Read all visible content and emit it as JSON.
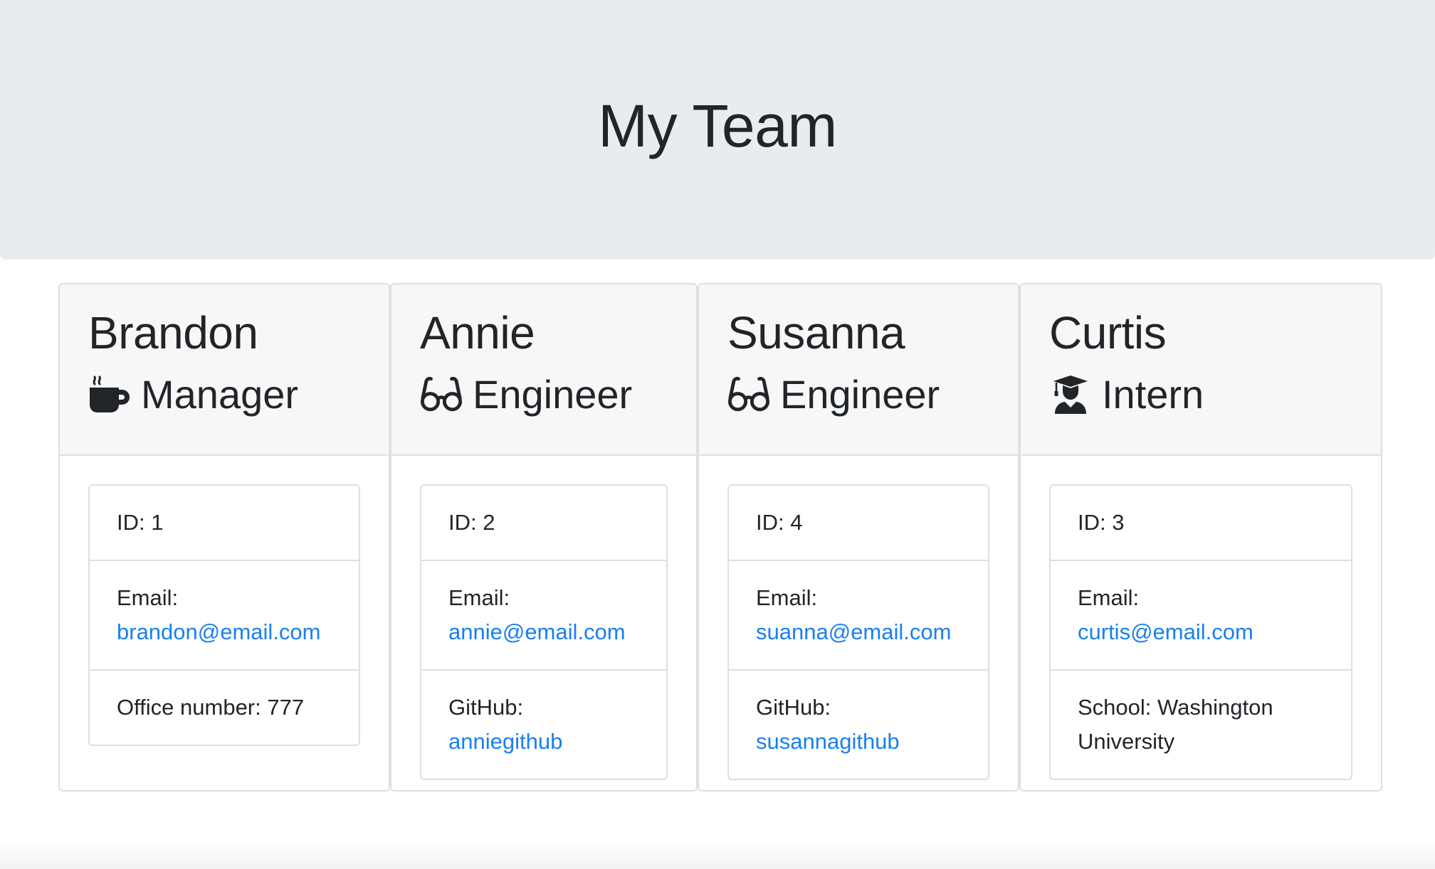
{
  "header": {
    "title": "My Team"
  },
  "team": [
    {
      "name": "Brandon",
      "role": "Manager",
      "icon": "coffee-icon",
      "id_text": "ID: 1",
      "email_label": "Email:",
      "email": "brandon@email.com",
      "extra_label": "Office number: 777",
      "extra_value": ""
    },
    {
      "name": "Annie",
      "role": "Engineer",
      "icon": "glasses-icon",
      "id_text": "ID: 2",
      "email_label": "Email:",
      "email": "annie@email.com",
      "extra_label": "GitHub:",
      "extra_value": "anniegithub"
    },
    {
      "name": "Susanna",
      "role": "Engineer",
      "icon": "glasses-icon",
      "id_text": "ID: 4",
      "email_label": "Email:",
      "email": "suanna@email.com",
      "extra_label": "GitHub:",
      "extra_value": "susannagithub"
    },
    {
      "name": "Curtis",
      "role": "Intern",
      "icon": "graduate-icon",
      "id_text": "ID: 3",
      "email_label": "Email:",
      "email": "curtis@email.com",
      "extra_label": "School: Washington University",
      "extra_value": ""
    }
  ],
  "colors": {
    "jumbotron_bg": "#e9ecef",
    "card_header_bg": "#f7f7f7",
    "link": "#1a7ff0",
    "text": "#212529",
    "border": "#dfdfdf"
  }
}
